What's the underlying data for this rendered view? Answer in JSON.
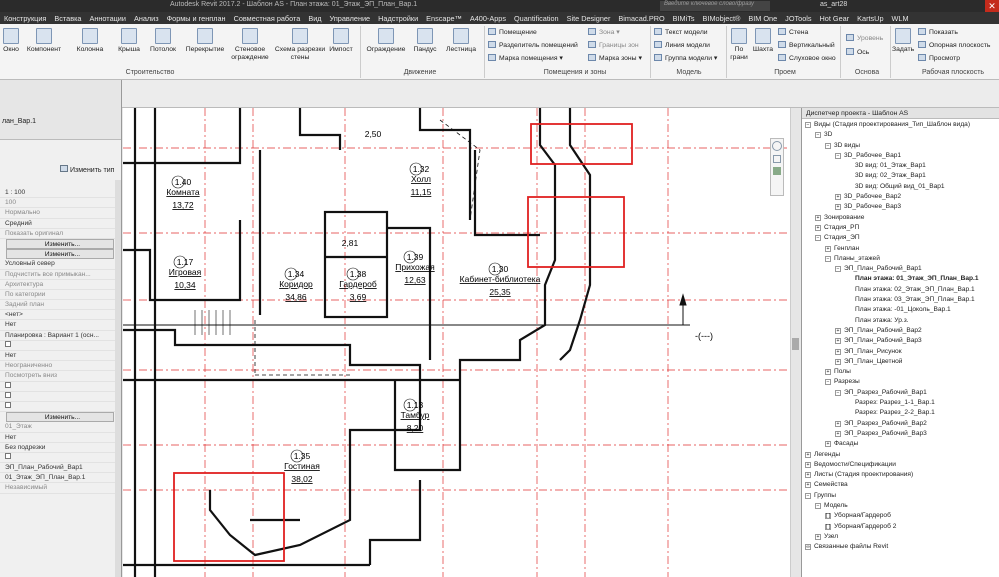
{
  "titlebar": {
    "title": "Autodesk Revit 2017.2  -  Шаблон AS  -  План этажа: 01_Этаж_ЭП_План_Вар.1",
    "search_placeholder": "Введите ключевое слово/фразу",
    "user": "as_art28",
    "close": "✕"
  },
  "menubar": [
    "Конструкция",
    "Вставка",
    "Аннотации",
    "Анализ",
    "Формы и генплан",
    "Совместная работа",
    "Вид",
    "Управление",
    "Надстройки",
    "Enscape™",
    "A400-Apps",
    "Quantification",
    "Site Designer",
    "Bimacad.PRO",
    "BIMiTs",
    "BIMobject®",
    "BIM One",
    "JOTools",
    "Hot Gear",
    "KartsUp",
    "WLM"
  ],
  "ribbon": {
    "stroitelstvo": {
      "label": "Строительство",
      "items": [
        "Окно",
        "Компонент",
        "Колонна",
        "Крыша",
        "Потолок",
        "Перекрытие",
        "Стеновое ограждение",
        "Схема разрезки стены",
        "Импост"
      ]
    },
    "dvizhenie": {
      "label": "Движение",
      "items": [
        "Ограждение",
        "Пандус",
        "Лестница"
      ]
    },
    "pomeshcheniya": {
      "label": "Помещения и зоны",
      "items": [
        "Помещение",
        "Разделитель помещений",
        "Марка помещения",
        "Зона",
        "Границы зон",
        "Марка зоны"
      ]
    },
    "model": {
      "label": "Модель",
      "items": [
        "Текст модели",
        "Линия модели",
        "Группа модели"
      ]
    },
    "proem": {
      "label": "Проем",
      "items": [
        "По грани",
        "Шахта",
        "Стена",
        "Вертикальный",
        "Слуховое окно"
      ]
    },
    "osnova": {
      "label": "Основа",
      "items": [
        "Уровень",
        "Ось"
      ]
    },
    "rabochaya": {
      "label": "Рабочая плоскость",
      "items": [
        "Задать",
        "Показать",
        "Опорная плоскость",
        "Просмотр"
      ]
    }
  },
  "properties": {
    "type_value": "лан_Вар.1",
    "edit_type": "Изменить тип",
    "rows": [
      "1 : 100",
      "100",
      "Нормально",
      "Средний",
      "Показать оригинал",
      "Изменить...",
      "Изменить...",
      "Условный север",
      "Подчистить все примыкан...",
      "Архитектура",
      "По категории",
      "Задний план",
      "<нет>",
      "Нет",
      "Планировка : Вариант 1 (осн...",
      "",
      "Нет",
      "Неограниченно",
      "Посмотреть вниз",
      "",
      "",
      "",
      "Изменить...",
      "01_Этаж",
      "Нет",
      "Без подрезки",
      "",
      "ЭП_План_Рабочий_Вар1",
      "01_Этаж_ЭП_План_Вар.1",
      "Независимый"
    ]
  },
  "rooms": [
    {
      "num": "2,50",
      "name": "",
      "area": ""
    },
    {
      "num": "1.40",
      "name": "Комната",
      "area": "13,72"
    },
    {
      "num": "1.32",
      "name": "Холл",
      "area": "11,15"
    },
    {
      "num": "2,81",
      "name": "",
      "area": ""
    },
    {
      "num": "1.17",
      "name": "Игровая",
      "area": "10,34"
    },
    {
      "num": "1.34",
      "name": "Коридор",
      "area": "34,86"
    },
    {
      "num": "1.38",
      "name": "Гардероб",
      "area": "3,69"
    },
    {
      "num": "1.39",
      "name": "Прихожая",
      "area": "12,63"
    },
    {
      "num": "1.30",
      "name": "Кабинет-библиотека",
      "area": "25,35"
    },
    {
      "num": "1.13",
      "name": "Тамбур",
      "area": "8,20"
    },
    {
      "num": "1.35",
      "name": "Гостиная",
      "area": "38,02"
    }
  ],
  "section_mark": "-(---)",
  "browser": {
    "header": "Диспетчер проекта - Шаблон AS",
    "nodes": [
      {
        "t": "Виды (Стадия проектирования_Тип_Шаблон вида)",
        "d": 0,
        "tg": "−"
      },
      {
        "t": "3D",
        "d": 1,
        "tg": "−"
      },
      {
        "t": "3D виды",
        "d": 2,
        "tg": "−"
      },
      {
        "t": "3D_Рабочее_Вар1",
        "d": 3,
        "tg": "−"
      },
      {
        "t": "3D вид: 01_Этаж_Вар1",
        "d": 5,
        "tg": ""
      },
      {
        "t": "3D вид: 02_Этаж_Вар1",
        "d": 5,
        "tg": ""
      },
      {
        "t": "3D вид: Общий вид_01_Вар1",
        "d": 5,
        "tg": ""
      },
      {
        "t": "3D_Рабочее_Вар2",
        "d": 3,
        "tg": "+"
      },
      {
        "t": "3D_Рабочее_Вар3",
        "d": 3,
        "tg": "+"
      },
      {
        "t": "Зонирование",
        "d": 1,
        "tg": "+"
      },
      {
        "t": "Стадия_РП",
        "d": 1,
        "tg": "+"
      },
      {
        "t": "Стадия_ЭП",
        "d": 1,
        "tg": "−"
      },
      {
        "t": "Генплан",
        "d": 2,
        "tg": "+"
      },
      {
        "t": "Планы_этажей",
        "d": 2,
        "tg": "−"
      },
      {
        "t": "ЭП_План_Рабочий_Вар1",
        "d": 3,
        "tg": "−"
      },
      {
        "t": "План этажа: 01_Этаж_ЭП_План_Вар.1",
        "d": 5,
        "tg": "",
        "bold": true
      },
      {
        "t": "План этажа: 02_Этаж_ЭП_План_Вар.1",
        "d": 5,
        "tg": ""
      },
      {
        "t": "План этажа: 03_Этаж_ЭП_План_Вар.1",
        "d": 5,
        "tg": ""
      },
      {
        "t": "План этажа: -01_Цоколь_Вар.1",
        "d": 5,
        "tg": ""
      },
      {
        "t": "План этажа: Ур.з.",
        "d": 5,
        "tg": ""
      },
      {
        "t": "ЭП_План_Рабочий_Вар2",
        "d": 3,
        "tg": "+"
      },
      {
        "t": "ЭП_План_Рабочий_Вар3",
        "d": 3,
        "tg": "+"
      },
      {
        "t": "ЭП_План_Рисунок",
        "d": 3,
        "tg": "+"
      },
      {
        "t": "ЭП_План_Цветной",
        "d": 3,
        "tg": "+"
      },
      {
        "t": "Полы",
        "d": 2,
        "tg": "+"
      },
      {
        "t": "Разрезы",
        "d": 2,
        "tg": "−"
      },
      {
        "t": "ЭП_Разрез_Рабочий_Вар1",
        "d": 3,
        "tg": "−"
      },
      {
        "t": "Разрез: Разрез_1-1_Вар.1",
        "d": 5,
        "tg": ""
      },
      {
        "t": "Разрез: Разрез_2-2_Вар.1",
        "d": 5,
        "tg": ""
      },
      {
        "t": "ЭП_Разрез_Рабочий_Вар2",
        "d": 3,
        "tg": "+"
      },
      {
        "t": "ЭП_Разрез_Рабочий_Вар3",
        "d": 3,
        "tg": "+"
      },
      {
        "t": "Фасады",
        "d": 2,
        "tg": "+"
      },
      {
        "t": "Легенды",
        "d": 0,
        "tg": "+"
      },
      {
        "t": "Ведомости/Спецификации",
        "d": 0,
        "tg": "+"
      },
      {
        "t": "Листы (Стадия проектирования)",
        "d": 0,
        "tg": "+"
      },
      {
        "t": "Семейства",
        "d": 0,
        "tg": "+"
      },
      {
        "t": "Группы",
        "d": 0,
        "tg": "−"
      },
      {
        "t": "Модель",
        "d": 1,
        "tg": "−"
      },
      {
        "t": "Уборная/Гардероб",
        "d": 2,
        "tg": "[ ]"
      },
      {
        "t": "Уборная/Гардероб 2",
        "d": 2,
        "tg": "[ ]"
      },
      {
        "t": "Узел",
        "d": 1,
        "tg": "+"
      },
      {
        "t": "Связанные файлы Revit",
        "d": 0,
        "tg": "∞"
      }
    ]
  },
  "colors": {
    "highlight": "#e02020",
    "grid": "#e04040",
    "wall": "#111111"
  }
}
